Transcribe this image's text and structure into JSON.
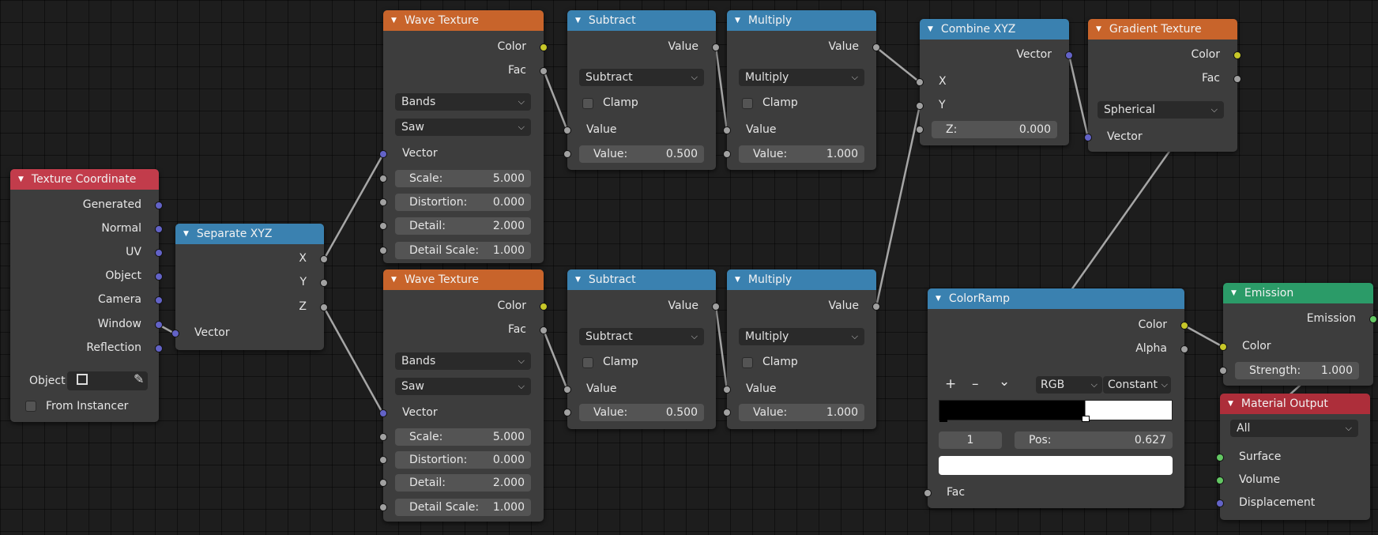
{
  "nodes": {
    "texture_coordinate": {
      "title": "Texture Coordinate",
      "outputs": [
        "Generated",
        "Normal",
        "UV",
        "Object",
        "Camera",
        "Window",
        "Reflection"
      ],
      "object_label": "Object",
      "from_instancer": "From Instancer"
    },
    "separate_xyz": {
      "title": "Separate XYZ",
      "outputs": [
        "X",
        "Y",
        "Z"
      ],
      "input": "Vector"
    },
    "wave_1": {
      "title": "Wave Texture",
      "outputs": [
        "Color",
        "Fac"
      ],
      "type": "Bands",
      "profile": "Saw",
      "vector": "Vector",
      "fields": [
        {
          "label": "Scale:",
          "value": "5.000"
        },
        {
          "label": "Distortion:",
          "value": "0.000"
        },
        {
          "label": "Detail:",
          "value": "2.000"
        },
        {
          "label": "Detail Scale:",
          "value": "1.000"
        }
      ]
    },
    "wave_2": {
      "title": "Wave Texture",
      "outputs": [
        "Color",
        "Fac"
      ],
      "type": "Bands",
      "profile": "Saw",
      "vector": "Vector",
      "fields": [
        {
          "label": "Scale:",
          "value": "5.000"
        },
        {
          "label": "Distortion:",
          "value": "0.000"
        },
        {
          "label": "Detail:",
          "value": "2.000"
        },
        {
          "label": "Detail Scale:",
          "value": "1.000"
        }
      ]
    },
    "subtract_1": {
      "title": "Subtract",
      "output": "Value",
      "operation": "Subtract",
      "clamp": "Clamp",
      "input": "Value",
      "field": {
        "label": "Value:",
        "value": "0.500"
      }
    },
    "subtract_2": {
      "title": "Subtract",
      "output": "Value",
      "operation": "Subtract",
      "clamp": "Clamp",
      "input": "Value",
      "field": {
        "label": "Value:",
        "value": "0.500"
      }
    },
    "multiply_1": {
      "title": "Multiply",
      "output": "Value",
      "operation": "Multiply",
      "clamp": "Clamp",
      "input": "Value",
      "field": {
        "label": "Value:",
        "value": "1.000"
      }
    },
    "multiply_2": {
      "title": "Multiply",
      "output": "Value",
      "operation": "Multiply",
      "clamp": "Clamp",
      "input": "Value",
      "field": {
        "label": "Value:",
        "value": "1.000"
      }
    },
    "combine_xyz": {
      "title": "Combine XYZ",
      "output": "Vector",
      "inputs": [
        "X",
        "Y"
      ],
      "field": {
        "label": "Z:",
        "value": "0.000"
      }
    },
    "gradient_texture": {
      "title": "Gradient Texture",
      "outputs": [
        "Color",
        "Fac"
      ],
      "type": "Spherical",
      "input": "Vector"
    },
    "colorramp": {
      "title": "ColorRamp",
      "outputs": [
        "Color",
        "Alpha"
      ],
      "add": "+",
      "remove": "–",
      "menu": "⌄",
      "color_mode": "RGB",
      "interpolation": "Constant",
      "active_stop": "1",
      "pos_label": "Pos:",
      "pos_value": "0.627",
      "stop_position": 0.627,
      "input": "Fac"
    },
    "emission": {
      "title": "Emission",
      "output": "Emission",
      "input": "Color",
      "field": {
        "label": "Strength:",
        "value": "1.000"
      }
    },
    "material_output": {
      "title": "Material Output",
      "target": "All",
      "inputs": [
        "Surface",
        "Volume",
        "Displacement"
      ]
    }
  },
  "colors": {
    "input_header": "#c23c4b",
    "texture_header": "#c8642b",
    "converter_header": "#3a81b0",
    "shader_header": "#2b9b68",
    "output_header": "#ad2e3a",
    "socket_float": "#a1a1a1",
    "socket_color": "#c7c729",
    "socket_vector": "#6363c7",
    "socket_shader": "#63c763",
    "wire": "#a6a6a6"
  }
}
